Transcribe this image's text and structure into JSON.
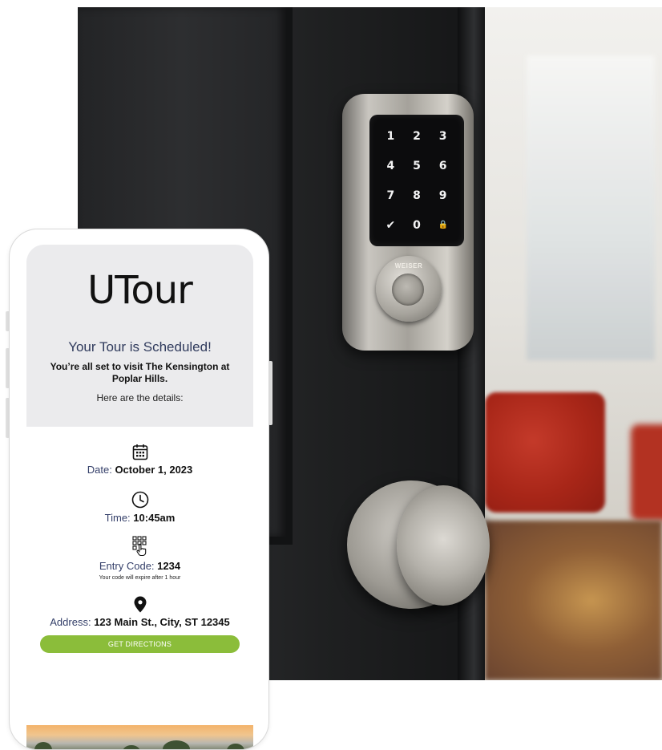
{
  "lock_keys": [
    "1",
    "2",
    "3",
    "4",
    "5",
    "6",
    "7",
    "8",
    "9",
    "✔",
    "0",
    "🔒"
  ],
  "lock_brand": "WEISER",
  "app": {
    "brand": "UTour",
    "title": "Your Tour is Scheduled!",
    "subtitle": "You’re all set to visit The Kensington at Poplar Hills.",
    "details_intro": "Here are the details:"
  },
  "details": {
    "date": {
      "label": "Date:",
      "value": "October 1, 2023",
      "icon": "calendar-icon"
    },
    "time": {
      "label": "Time:",
      "value": "10:45am",
      "icon": "clock-icon"
    },
    "entry": {
      "label": "Entry Code:",
      "value": "1234",
      "note": "Your code will expire after 1 hour",
      "icon": "keypad-icon"
    },
    "address": {
      "label": "Address:",
      "value": "123 Main St., City, ST 12345",
      "icon": "location-pin-icon"
    }
  },
  "cta": {
    "label": "GET DIRECTIONS"
  },
  "colors": {
    "accent_green": "#8bbd3a",
    "heading_navy": "#2f3a5c",
    "header_bg": "#ebebed"
  }
}
